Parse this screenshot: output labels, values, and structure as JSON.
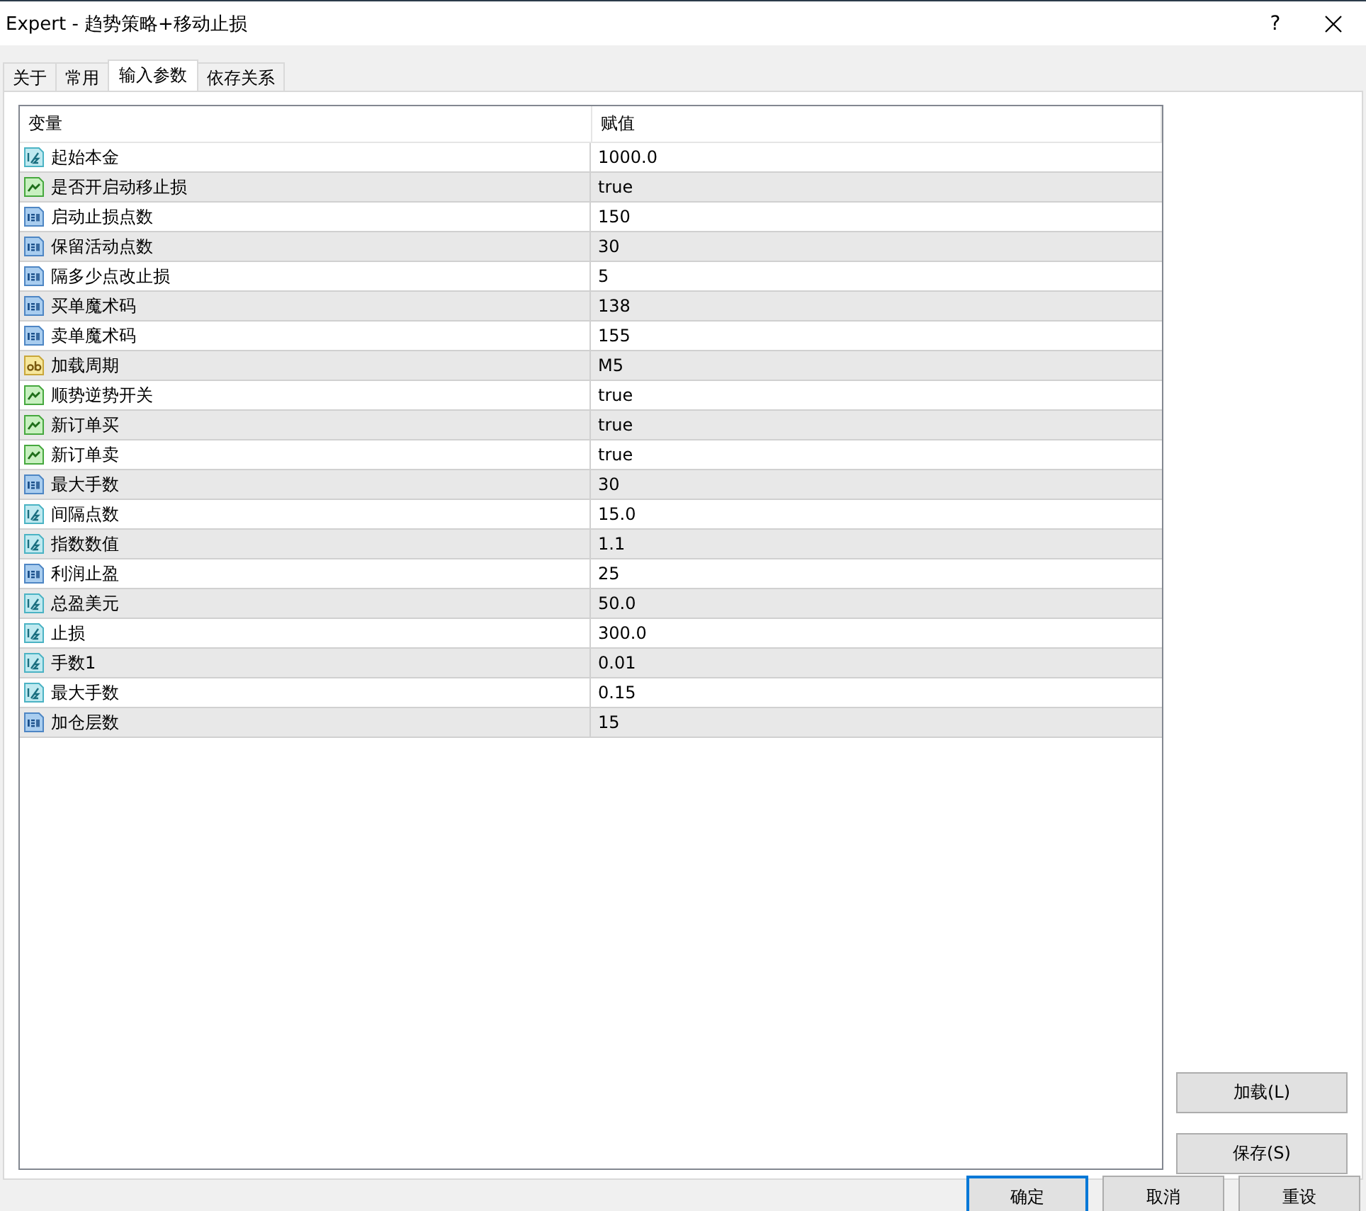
{
  "window": {
    "title": "Expert - 趋势策略+移动止损",
    "help": "?"
  },
  "tabs": [
    {
      "label": "关于",
      "selected": false
    },
    {
      "label": "常用",
      "selected": false
    },
    {
      "label": "输入参数",
      "selected": true
    },
    {
      "label": "依存关系",
      "selected": false
    }
  ],
  "table": {
    "columns": [
      "变量",
      "赋值"
    ],
    "rows": [
      {
        "kind": "double",
        "name": "起始本金",
        "value": "1000.0"
      },
      {
        "kind": "bool",
        "name": "是否开启动移止损",
        "value": "true"
      },
      {
        "kind": "int",
        "name": "启动止损点数",
        "value": "150"
      },
      {
        "kind": "int",
        "name": "保留活动点数",
        "value": "30"
      },
      {
        "kind": "int",
        "name": "隔多少点改止损",
        "value": "5"
      },
      {
        "kind": "int",
        "name": "买单魔术码",
        "value": "138"
      },
      {
        "kind": "int",
        "name": "卖单魔术码",
        "value": "155"
      },
      {
        "kind": "string",
        "name": "加载周期",
        "value": "M5"
      },
      {
        "kind": "bool",
        "name": "顺势逆势开关",
        "value": "true"
      },
      {
        "kind": "bool",
        "name": "新订单买",
        "value": "true"
      },
      {
        "kind": "bool",
        "name": "新订单卖",
        "value": "true"
      },
      {
        "kind": "int",
        "name": "最大手数",
        "value": "30"
      },
      {
        "kind": "double",
        "name": "间隔点数",
        "value": "15.0"
      },
      {
        "kind": "double",
        "name": "指数数值",
        "value": "1.1"
      },
      {
        "kind": "int",
        "name": "利润止盈",
        "value": "25"
      },
      {
        "kind": "double",
        "name": "总盈美元",
        "value": "50.0"
      },
      {
        "kind": "double",
        "name": "止损",
        "value": "300.0"
      },
      {
        "kind": "double",
        "name": "手数1",
        "value": "0.01"
      },
      {
        "kind": "double",
        "name": "最大手数",
        "value": "0.15"
      },
      {
        "kind": "int",
        "name": "加仓层数",
        "value": "15"
      }
    ]
  },
  "side_buttons": [
    "加载(L)",
    "保存(S)"
  ],
  "footer_buttons": [
    {
      "label": "确定",
      "default": true
    },
    {
      "label": "取消",
      "default": false
    },
    {
      "label": "重设",
      "default": false
    }
  ]
}
